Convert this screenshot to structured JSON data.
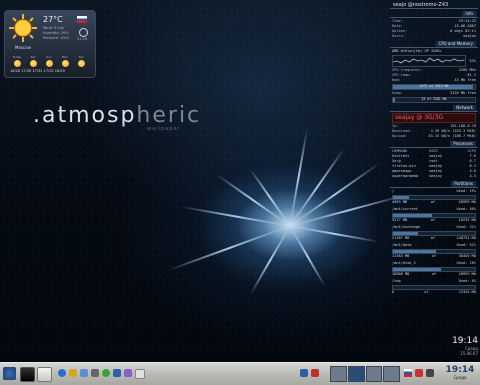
{
  "desktop": {
    "brand": {
      "part1": ".atmosp",
      "part2": "heric",
      "sub": "wallpaper"
    }
  },
  "weather": {
    "temperature": "27°C",
    "details": [
      "Wind: 5 m/s",
      "Humidity: 29%",
      "Pressure: 1014"
    ],
    "sunrise": "4:58",
    "sunset": "21:18",
    "city": "Moscow",
    "forecast_days": [
      "Today",
      "Sat",
      "Sun",
      "Mon",
      "Tue"
    ],
    "forecast_temps": "16/28  17/30  17/32  17/32  18/29"
  },
  "conky": {
    "hostname": "seajo @nostromo-Z43",
    "info": {
      "title": "Info",
      "rows": [
        {
          "k": "Time:",
          "v": "19:14:22"
        },
        {
          "k": "Date:",
          "v": "15.06.2007"
        },
        {
          "k": "Uptime:",
          "v": "0 days 02:11"
        },
        {
          "k": "Users:",
          "v": "seajay"
        }
      ]
    },
    "cpu": {
      "title": "CPU and Memory",
      "model": "AMD Athlon(tm) XP 3200+",
      "graph_label": "53%",
      "rows": [
        {
          "k": "CPU frequency:",
          "v": "2205 MHz"
        },
        {
          "k": "CPU temp:",
          "v": "61 C"
        }
      ],
      "ram_label": "Ram:",
      "ram_text": "43 Mb free",
      "ram_used": "1477 of 1519 Mb",
      "ram_fill": 0.97,
      "swap_label": "Swap:",
      "swap_text": "3120 Mb free",
      "swap_used": "33 of 3161 Mb",
      "swap_fill": 0.02
    },
    "network": {
      "title": "Network",
      "badge": "seajay @ 3G/3G",
      "rows": [
        {
          "k": "Ip:",
          "v": "192.168.0.78"
        },
        {
          "k": "Download:",
          "v": "4.39 kB/s  (353.3 MiB)"
        },
        {
          "k": "Upload:",
          "v": "43.15 kB/s  (106.7 MiB)"
        }
      ]
    },
    "processes": {
      "title": "Processes",
      "headers": [
        "COMMAND",
        "USER",
        "%CPU"
      ],
      "rows": [
        [
          "ktorrent",
          "seajay",
          "7.6"
        ],
        [
          "Xorg",
          "root",
          "6.7"
        ],
        [
          "firefox-bin",
          "seajay",
          "6.3"
        ],
        [
          "amarokapp",
          "seajay",
          "4.6"
        ],
        [
          "superkaramba",
          "seajay",
          "4.3"
        ]
      ]
    },
    "partitions": {
      "title": "Partitions",
      "items": [
        {
          "mount": "/",
          "used_label": "Used: 19%",
          "used": "4983 MB",
          "of": "of",
          "total": "28999 Mb",
          "free_label": "Free: 77%",
          "fill": 0.19
        },
        {
          "mount": "/mnt/current",
          "used_label": "Used: 48%",
          "used": "3217 MB",
          "of": "of",
          "total": "18235 Mb",
          "free_label": "Used: 48%",
          "fill": 0.48
        },
        {
          "mount": "/mnt/exchange",
          "used_label": "Used: 31%",
          "used": "21307 MB",
          "of": "of",
          "total": "148754 Mb",
          "free_label": "Used: 31%",
          "fill": 0.31
        },
        {
          "mount": "/mnt/data",
          "used_label": "Used: 52%",
          "used": "11583 MB",
          "of": "of",
          "total": "38450 Mb",
          "free_label": "Used: 52%",
          "fill": 0.52
        },
        {
          "mount": "/mnt/disk_2",
          "used_label": "Used: 18%",
          "used": "16888 MB",
          "of": "of",
          "total": "28999 Mb",
          "free_label": "Used: 18%",
          "fill": 0.58
        },
        {
          "mount": "/tmp",
          "used_label": "Used: 0%",
          "used": "0",
          "of": "of",
          "total": "15345 Mb",
          "free_label": "",
          "fill": 0.0
        }
      ]
    }
  },
  "clock": {
    "time": "19:14",
    "day": "Среда",
    "date": "15.06.07"
  },
  "taskbar": {
    "launcher_icons": [
      "kde-menu-icon",
      "terminal-icon",
      "mail-icon",
      "browser-icon",
      "media-icon",
      "folder-icon",
      "settings-icon",
      "chat-icon",
      "music-icon",
      "photo-icon",
      "document-icon"
    ],
    "tray_icons": [
      "network-icon",
      "volume-icon",
      "flag-icon",
      "update-icon",
      "battery-icon"
    ],
    "pager_active": 1,
    "pager_count": 4,
    "clock_time": "19:14",
    "clock_day": "Среда",
    "clock_date": "15/06/07"
  },
  "colors": {
    "panel_accent": "#4f7399",
    "net_alert": "#ff5a5a",
    "taskbar": "#bdbdb8"
  }
}
